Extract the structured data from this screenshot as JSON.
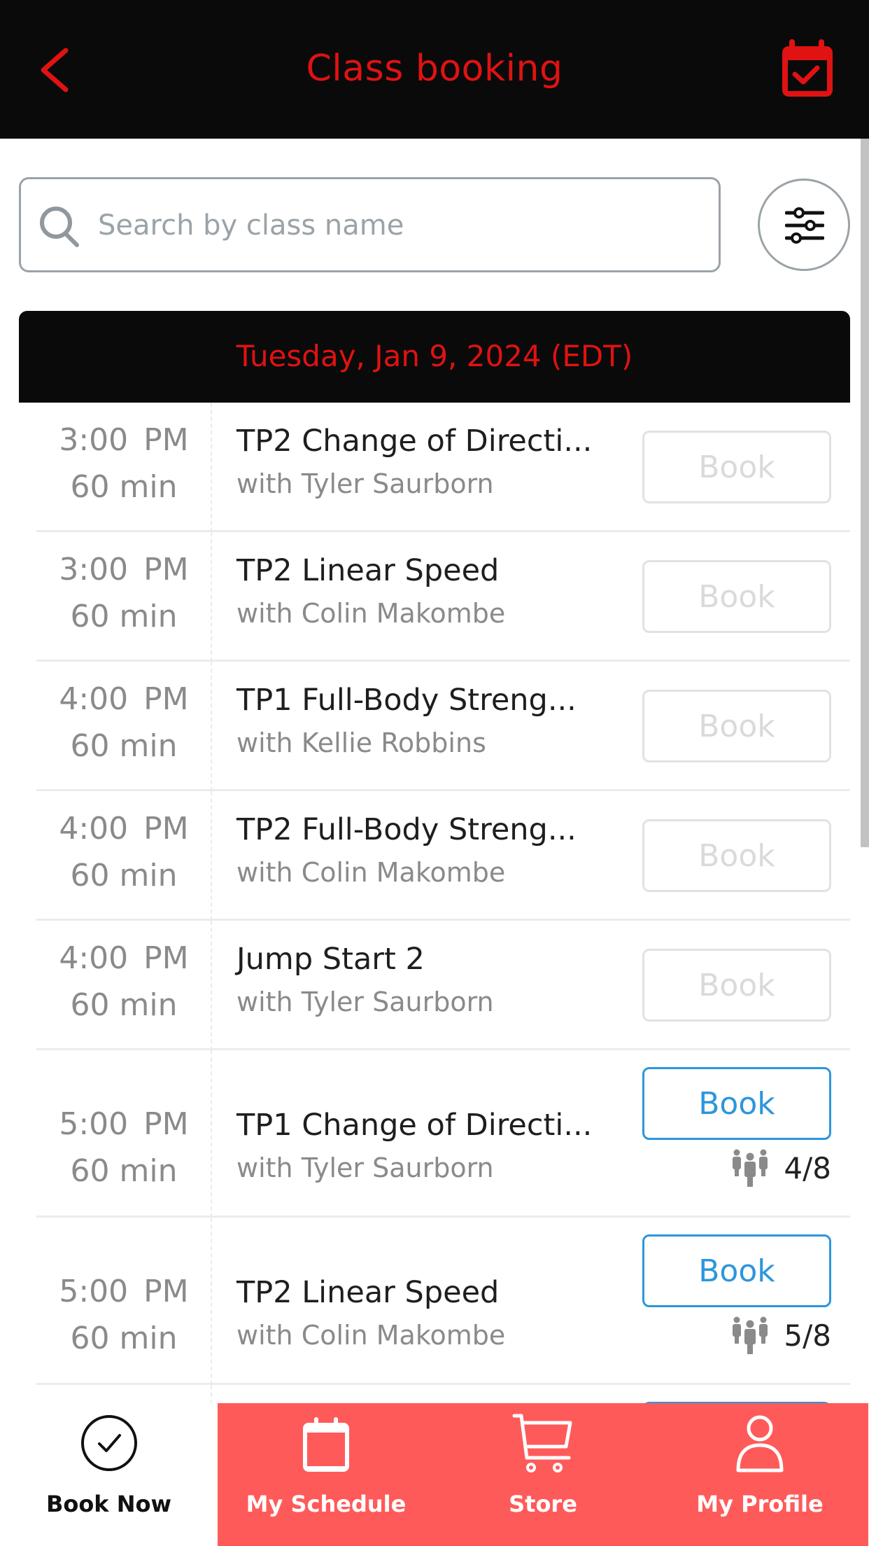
{
  "header": {
    "title": "Class booking",
    "back_icon": "chevron-left-icon",
    "right_icon": "calendar-check-icon"
  },
  "search": {
    "placeholder": "Search by class name",
    "value": "",
    "icon": "search-icon"
  },
  "filter": {
    "icon": "sliders-icon"
  },
  "date_header": "Tuesday, Jan 9, 2024 (EDT)",
  "colors": {
    "header_bg": "#0a0a0a",
    "accent_red": "#e01212",
    "nav_red": "#ff5a5a",
    "book_blue": "#2d96dc",
    "disabled_gray": "#dadada"
  },
  "classes": [
    {
      "time": "3:00  PM",
      "duration": "60 min",
      "name": "TP2 Change of Directi...",
      "instructor": "with Tyler Saurborn",
      "book_label": "Book",
      "state": "disabled",
      "capacity": null
    },
    {
      "time": "3:00  PM",
      "duration": "60 min",
      "name": "TP2 Linear Speed",
      "instructor": "with Colin Makombe",
      "book_label": "Book",
      "state": "disabled",
      "capacity": null
    },
    {
      "time": "4:00  PM",
      "duration": "60 min",
      "name": "TP1 Full-Body Streng...",
      "instructor": "with Kellie Robbins",
      "book_label": "Book",
      "state": "disabled",
      "capacity": null
    },
    {
      "time": "4:00  PM",
      "duration": "60 min",
      "name": "TP2 Full-Body Streng...",
      "instructor": "with Colin Makombe",
      "book_label": "Book",
      "state": "disabled",
      "capacity": null
    },
    {
      "time": "4:00  PM",
      "duration": "60 min",
      "name": "Jump Start 2",
      "instructor": "with Tyler Saurborn",
      "book_label": "Book",
      "state": "disabled",
      "capacity": null
    },
    {
      "time": "5:00  PM",
      "duration": "60 min",
      "name": "TP1 Change of Directi...",
      "instructor": "with Tyler Saurborn",
      "book_label": "Book",
      "state": "active",
      "capacity": "4/8"
    },
    {
      "time": "5:00  PM",
      "duration": "60 min",
      "name": "TP2 Linear Speed",
      "instructor": "with Colin Makombe",
      "book_label": "Book",
      "state": "active",
      "capacity": "5/8"
    }
  ],
  "bottom_nav": [
    {
      "label": "Book Now",
      "icon": "check-circle-icon",
      "active": true
    },
    {
      "label": "My Schedule",
      "icon": "calendar-icon",
      "active": false
    },
    {
      "label": "Store",
      "icon": "cart-icon",
      "active": false
    },
    {
      "label": "My Profile",
      "icon": "user-icon",
      "active": false
    }
  ]
}
